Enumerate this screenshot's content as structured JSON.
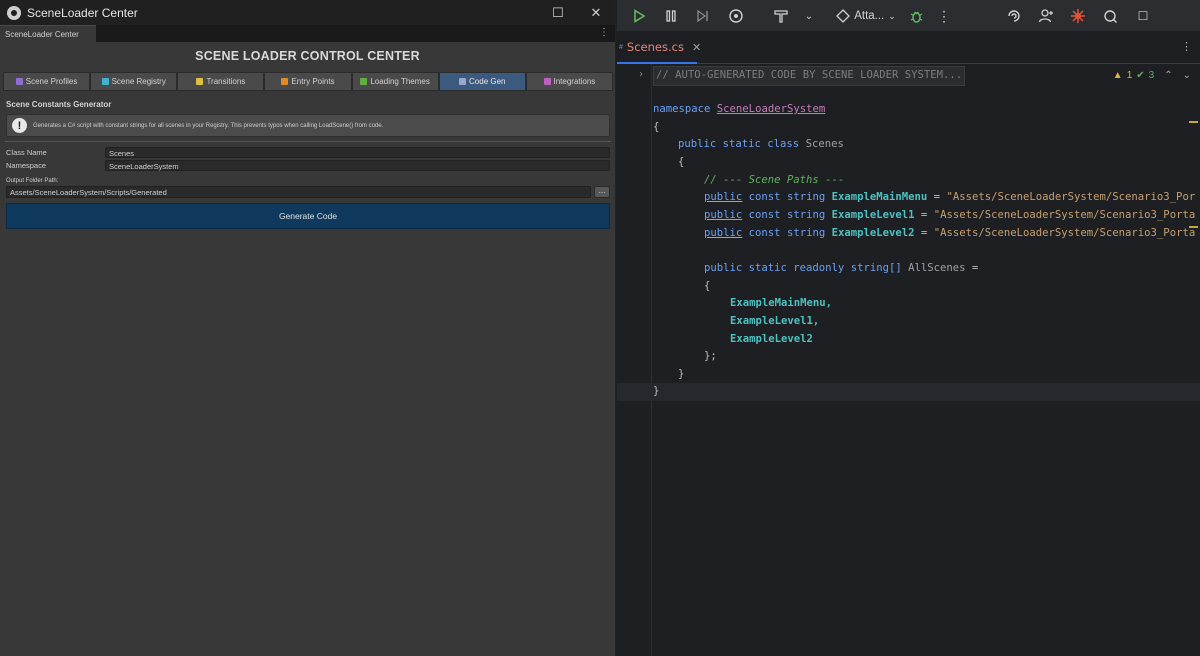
{
  "unity": {
    "window_title": "SceneLoader Center",
    "tab_label": "SceneLoader Center",
    "header": "SCENE LOADER CONTROL CENTER",
    "tabs": [
      {
        "label": "Scene Profiles",
        "color": "#8e6fd1"
      },
      {
        "label": "Scene Registry",
        "color": "#3db3d6"
      },
      {
        "label": "Transitions",
        "color": "#e0c040"
      },
      {
        "label": "Entry Points",
        "color": "#e08a30"
      },
      {
        "label": "Loading Themes",
        "color": "#60b040"
      },
      {
        "label": "Code Gen",
        "color": "#9aa6d0"
      },
      {
        "label": "Integrations",
        "color": "#c060c0"
      }
    ],
    "active_tab": "Code Gen",
    "section_title": "Scene Constants Generator",
    "help_text": "Generates a C# script with constant strings for all scenes in your Registry. This prevents typos when calling LoadScene() from code.",
    "fields": [
      {
        "label": "Class Name",
        "value": "Scenes"
      },
      {
        "label": "Namespace",
        "value": "SceneLoaderSystem"
      }
    ],
    "output_label": "Output Folder Path:",
    "output_path": "Assets/SceneLoaderSystem/Scripts/Generated",
    "browse_label": "...",
    "generate_label": "Generate Code"
  },
  "ide": {
    "run_config": "Atta...",
    "file_tab": "Scenes.cs",
    "inspection": {
      "warnings": "1",
      "ok": "3"
    },
    "code": {
      "l1": "// AUTO-GENERATED CODE BY SCENE LOADER SYSTEM...",
      "kw_namespace": "namespace",
      "ns_name": "SceneLoaderSystem",
      "open1": "{",
      "kw_class": "public static class",
      "class_name": "Scenes",
      "open2": "{",
      "comment_paths": "// --- Scene Paths ---",
      "kw_public": "public",
      "kw_const": "const string",
      "c1_name": "ExampleMainMenu",
      "c1_val": "\"Assets/SceneLoaderSystem/Scenario3_Por",
      "c2_name": "ExampleLevel1",
      "c2_val": "\"Assets/SceneLoaderSystem/Scenario3_Porta",
      "c3_name": "ExampleLevel2",
      "c3_val": "\"Assets/SceneLoaderSystem/Scenario3_Porta",
      "kw_readonly": "public static readonly string[]",
      "arr_name": "AllScenes",
      "eq": "=",
      "open3": "{",
      "a1": "ExampleMainMenu,",
      "a2": "ExampleLevel1,",
      "a3": "ExampleLevel2",
      "close3": "};",
      "close2": "}",
      "close1": "}"
    }
  }
}
